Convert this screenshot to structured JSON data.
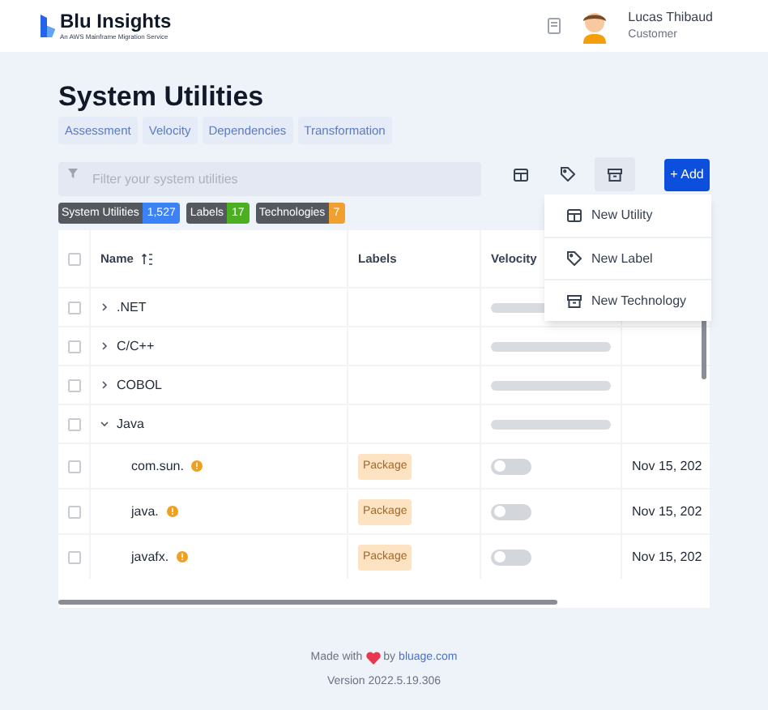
{
  "brand": {
    "name": "Blu Insights",
    "tagline": "An AWS Mainframe Migration Service"
  },
  "user": {
    "name": "Lucas Thibaud",
    "role": "Customer"
  },
  "page_title": "System Utilities",
  "nav_tabs": [
    "Assessment",
    "Velocity",
    "Dependencies",
    "Transformation"
  ],
  "filter": {
    "placeholder": "Filter your system utilities"
  },
  "view_buttons": [
    {
      "kind": "table",
      "selected": false
    },
    {
      "kind": "tag",
      "selected": false
    },
    {
      "kind": "archive",
      "selected": true
    }
  ],
  "add_button": "+ Add",
  "counters": [
    {
      "label": "System Utilities",
      "count": "1,527",
      "color": "#3b82f6"
    },
    {
      "label": "Labels",
      "count": "17",
      "color": "#4caf22"
    },
    {
      "label": "Technologies",
      "count": "7",
      "color": "#f0a030"
    }
  ],
  "add_menu": [
    {
      "kind": "table",
      "label": "New Utility"
    },
    {
      "kind": "tag",
      "label": "New Label"
    },
    {
      "kind": "archive",
      "label": "New Technology"
    }
  ],
  "table": {
    "select_all_checked": false,
    "columns": [
      "Name",
      "Labels",
      "Velocity"
    ],
    "rows": [
      {
        "kind": "group",
        "name": ".NET",
        "expanded": false,
        "checked": false
      },
      {
        "kind": "group",
        "name": "C/C++",
        "expanded": false,
        "checked": false
      },
      {
        "kind": "group",
        "name": "COBOL",
        "expanded": false,
        "checked": false
      },
      {
        "kind": "group",
        "name": "Java",
        "expanded": true,
        "checked": false
      },
      {
        "kind": "item",
        "name": "com.sun.",
        "label": "Package",
        "on": false,
        "date": "Nov 15, 202",
        "checked": false
      },
      {
        "kind": "item",
        "name": "java.",
        "label": "Package",
        "on": false,
        "date": "Nov 15, 202",
        "checked": false
      },
      {
        "kind": "item",
        "name": "javafx.",
        "label": "Package",
        "on": false,
        "date": "Nov 15, 202",
        "checked": false
      }
    ]
  },
  "footer": {
    "made_with": "Made with",
    "by": "by",
    "link": "bluage.com",
    "version": "Version 2022.5.19.306"
  }
}
